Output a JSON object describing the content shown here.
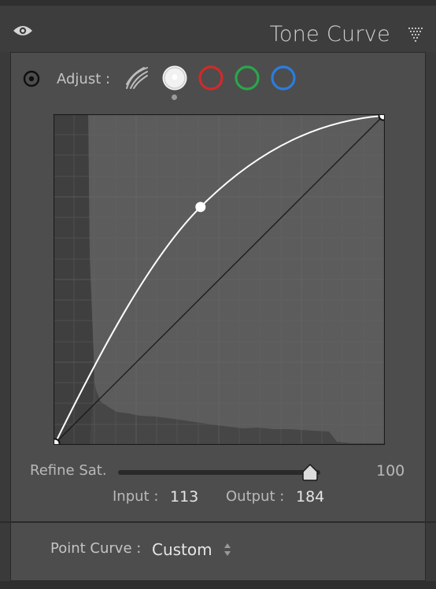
{
  "header": {
    "title": "Tone Curve",
    "visibility_icon": "eye-icon",
    "collapse_icon": "collapse-triangle-icon"
  },
  "adjust": {
    "target_icon": "targeted-adjustment-icon",
    "label": "Adjust :",
    "channels": [
      {
        "name": "parametric",
        "icon": "parametric-curve-icon"
      },
      {
        "name": "rgb",
        "icon": "white-circle-icon",
        "color": "#e8e8e8",
        "selected": true
      },
      {
        "name": "red",
        "icon": "red-circle-icon",
        "color": "#d02a2a"
      },
      {
        "name": "green",
        "icon": "green-circle-icon",
        "color": "#2aa64a"
      },
      {
        "name": "blue",
        "icon": "blue-circle-icon",
        "color": "#2a7ddf"
      }
    ]
  },
  "curve": {
    "points": [
      [
        0,
        0
      ],
      [
        113,
        184
      ],
      [
        255,
        255
      ]
    ],
    "selected_point": [
      113,
      184
    ]
  },
  "refine": {
    "label": "Refine Sat.",
    "value": "100",
    "level": 0.95
  },
  "io": {
    "input_label": "Input :",
    "input_value": "113",
    "output_label": "Output :",
    "output_value": "184"
  },
  "point_curve": {
    "label": "Point Curve :",
    "value": "Custom"
  }
}
